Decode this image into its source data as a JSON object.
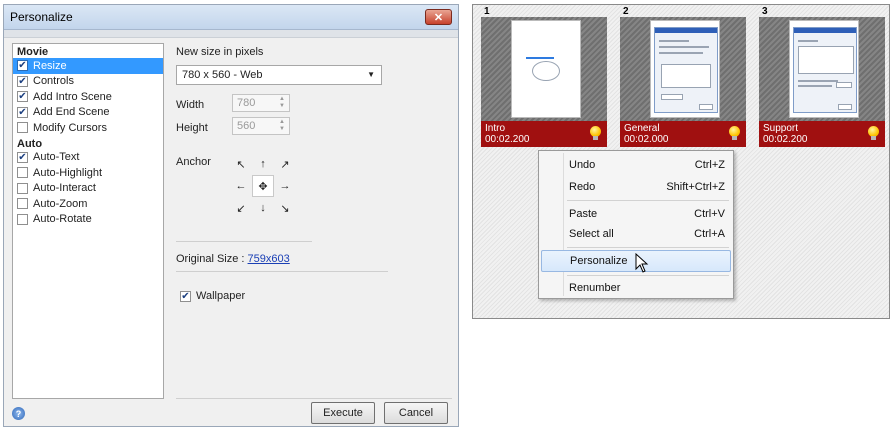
{
  "dialog": {
    "title": "Personalize",
    "close_glyph": "✕",
    "groups": [
      {
        "heading": "Movie",
        "options": [
          {
            "label": "Resize",
            "checked": true,
            "selected": true
          },
          {
            "label": "Controls",
            "checked": true,
            "selected": false
          },
          {
            "label": "Add Intro Scene",
            "checked": true,
            "selected": false
          },
          {
            "label": "Add End Scene",
            "checked": true,
            "selected": false
          },
          {
            "label": "Modify Cursors",
            "checked": false,
            "selected": false
          }
        ]
      },
      {
        "heading": "Auto",
        "options": [
          {
            "label": "Auto-Text",
            "checked": true,
            "selected": false
          },
          {
            "label": "Auto-Highlight",
            "checked": false,
            "selected": false
          },
          {
            "label": "Auto-Interact",
            "checked": false,
            "selected": false
          },
          {
            "label": "Auto-Zoom",
            "checked": false,
            "selected": false
          },
          {
            "label": "Auto-Rotate",
            "checked": false,
            "selected": false
          }
        ]
      }
    ],
    "resize": {
      "heading": "New size in pixels",
      "size_select": "780 x 560 - Web",
      "width_label": "Width",
      "width_value": "780",
      "height_label": "Height",
      "height_value": "560",
      "anchor_label": "Anchor",
      "original_size_label": "Original Size :",
      "original_size_value": "759x603",
      "wallpaper_label": "Wallpaper",
      "wallpaper_checked": true
    },
    "buttons": {
      "execute": "Execute",
      "cancel": "Cancel"
    },
    "help_glyph": "?"
  },
  "timeline": {
    "scenes": [
      {
        "number": "1",
        "name": "Intro",
        "time": "00:02.200"
      },
      {
        "number": "2",
        "name": "General",
        "time": "00:02.000"
      },
      {
        "number": "3",
        "name": "Support",
        "time": "00:02.200"
      }
    ]
  },
  "context_menu": {
    "items": [
      {
        "label": "Undo",
        "shortcut": "Ctrl+Z"
      },
      {
        "label": "Redo",
        "shortcut": "Shift+Ctrl+Z"
      },
      {
        "label": "Paste",
        "shortcut": "Ctrl+V"
      },
      {
        "label": "Select all",
        "shortcut": "Ctrl+A"
      },
      {
        "label": "Personalize",
        "shortcut": "",
        "highlighted": true
      },
      {
        "label": "Renumber",
        "shortcut": ""
      }
    ]
  },
  "colors": {
    "selection_blue": "#3399ff",
    "scene_bar_red": "#a01010",
    "link_blue": "#1a3fb5"
  },
  "icons": {
    "check": "✔",
    "dropdown_arrow": "▼",
    "bulb": "lightbulb-icon",
    "help": "help-icon",
    "cursor": "mouse-pointer-icon"
  }
}
